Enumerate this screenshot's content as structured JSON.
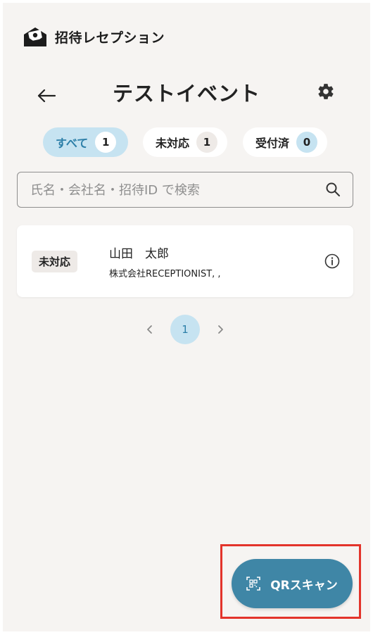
{
  "app": {
    "title": "招待レセプション"
  },
  "header": {
    "title": "テストイベント"
  },
  "filters": [
    {
      "label": "すべて",
      "count": "1"
    },
    {
      "label": "未対応",
      "count": "1"
    },
    {
      "label": "受付済",
      "count": "0"
    }
  ],
  "search": {
    "placeholder": "氏名・会社名・招待ID で検索",
    "value": ""
  },
  "guests": [
    {
      "status": "未対応",
      "name": "山田　太郎",
      "company": "株式会社RECEPTIONIST, ,"
    }
  ],
  "pagination": {
    "current": "1"
  },
  "fab": {
    "label": "QRスキャン"
  },
  "icons": {
    "logo": "envelope-logo-icon",
    "back": "arrow-left-icon",
    "settings": "gear-icon",
    "search": "search-icon",
    "info": "info-icon",
    "prev": "chevron-left-icon",
    "next": "chevron-right-icon",
    "qr": "qr-code-icon"
  },
  "colors": {
    "background": "#f6f4f2",
    "accent": "#3f86a6",
    "chip_active": "#c6e3f1",
    "highlight": "#e3342b"
  }
}
